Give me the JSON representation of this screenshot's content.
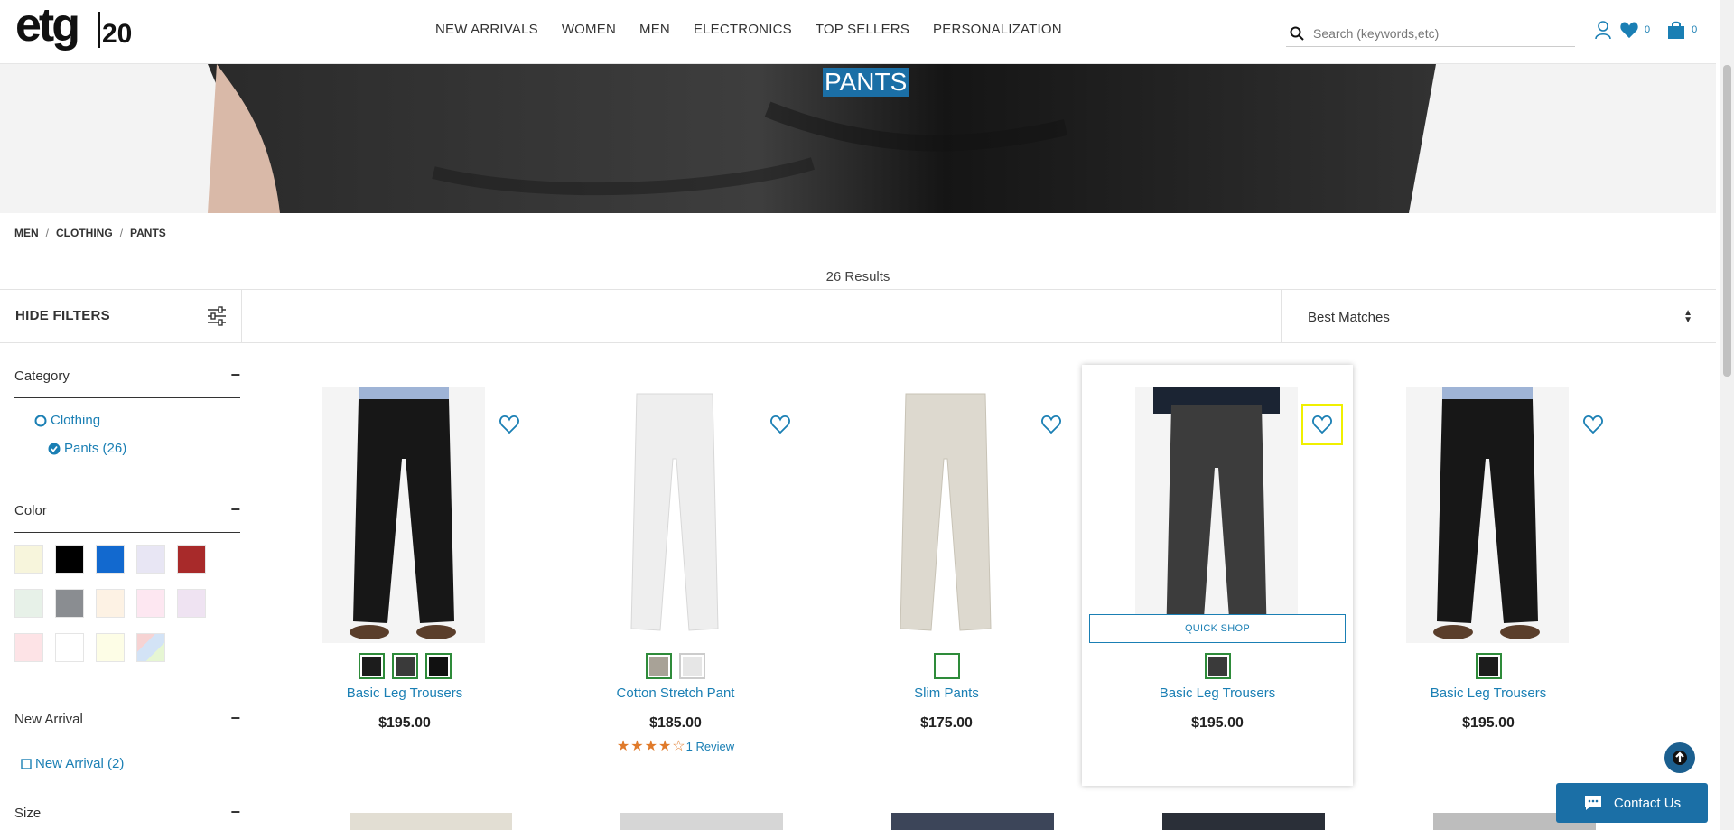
{
  "header": {
    "logo_text": "etg",
    "logo_number": "20",
    "nav": [
      "NEW ARRIVALS",
      "WOMEN",
      "MEN",
      "ELECTRONICS",
      "TOP SELLERS",
      "PERSONALIZATION"
    ],
    "search_placeholder": "Search (keywords,etc)",
    "wishlist_count": "0",
    "cart_count": "0"
  },
  "hero": {
    "title": "PANTS"
  },
  "breadcrumb": [
    "MEN",
    "CLOTHING",
    "PANTS"
  ],
  "results": "26 Results",
  "filterbar": {
    "hide_label": "HIDE FILTERS",
    "sort_value": "Best Matches"
  },
  "filters": {
    "category": {
      "title": "Category",
      "items": [
        "Clothing",
        "Pants (26)"
      ]
    },
    "color": {
      "title": "Color",
      "swatches": [
        "#f7f5dc",
        "#000000",
        "#1269cf",
        "#e8e6f4",
        "#a82a2a",
        "#e7f1e8",
        "#8a8d91",
        "#fdf2e4",
        "#fde7f1",
        "#efe3f2",
        "#fde3e6",
        "#ffffff",
        "#fdfde6",
        "multi"
      ]
    },
    "new_arrival": {
      "title": "New Arrival",
      "items": [
        "New Arrival (2)"
      ]
    },
    "size": {
      "title": "Size"
    }
  },
  "products": [
    {
      "name": "Basic Leg Trousers",
      "price": "$195.00",
      "colors": [
        "#1c1c1c",
        "#3a3a3a",
        "#111111"
      ],
      "pant": "#171717"
    },
    {
      "name": "Cotton Stretch Pant",
      "price": "$185.00",
      "colors": [
        "#a8a297",
        "#e6e6e6"
      ],
      "pant": "#f1f1f1",
      "rating": 4,
      "reviews": "1 Review"
    },
    {
      "name": "Slim Pants",
      "price": "$175.00",
      "colors": [
        "#ffffff"
      ],
      "pant": "#ddd9cf"
    },
    {
      "name": "Basic Leg Trousers",
      "price": "$195.00",
      "colors": [
        "#3a3a3a"
      ],
      "pant": "#3c3c3c",
      "quick_shop": "QUICK SHOP"
    },
    {
      "name": "Basic Leg Trousers",
      "price": "$195.00",
      "colors": [
        "#1c1c1c"
      ],
      "pant": "#171717"
    }
  ],
  "contact": {
    "label": "Contact Us"
  }
}
